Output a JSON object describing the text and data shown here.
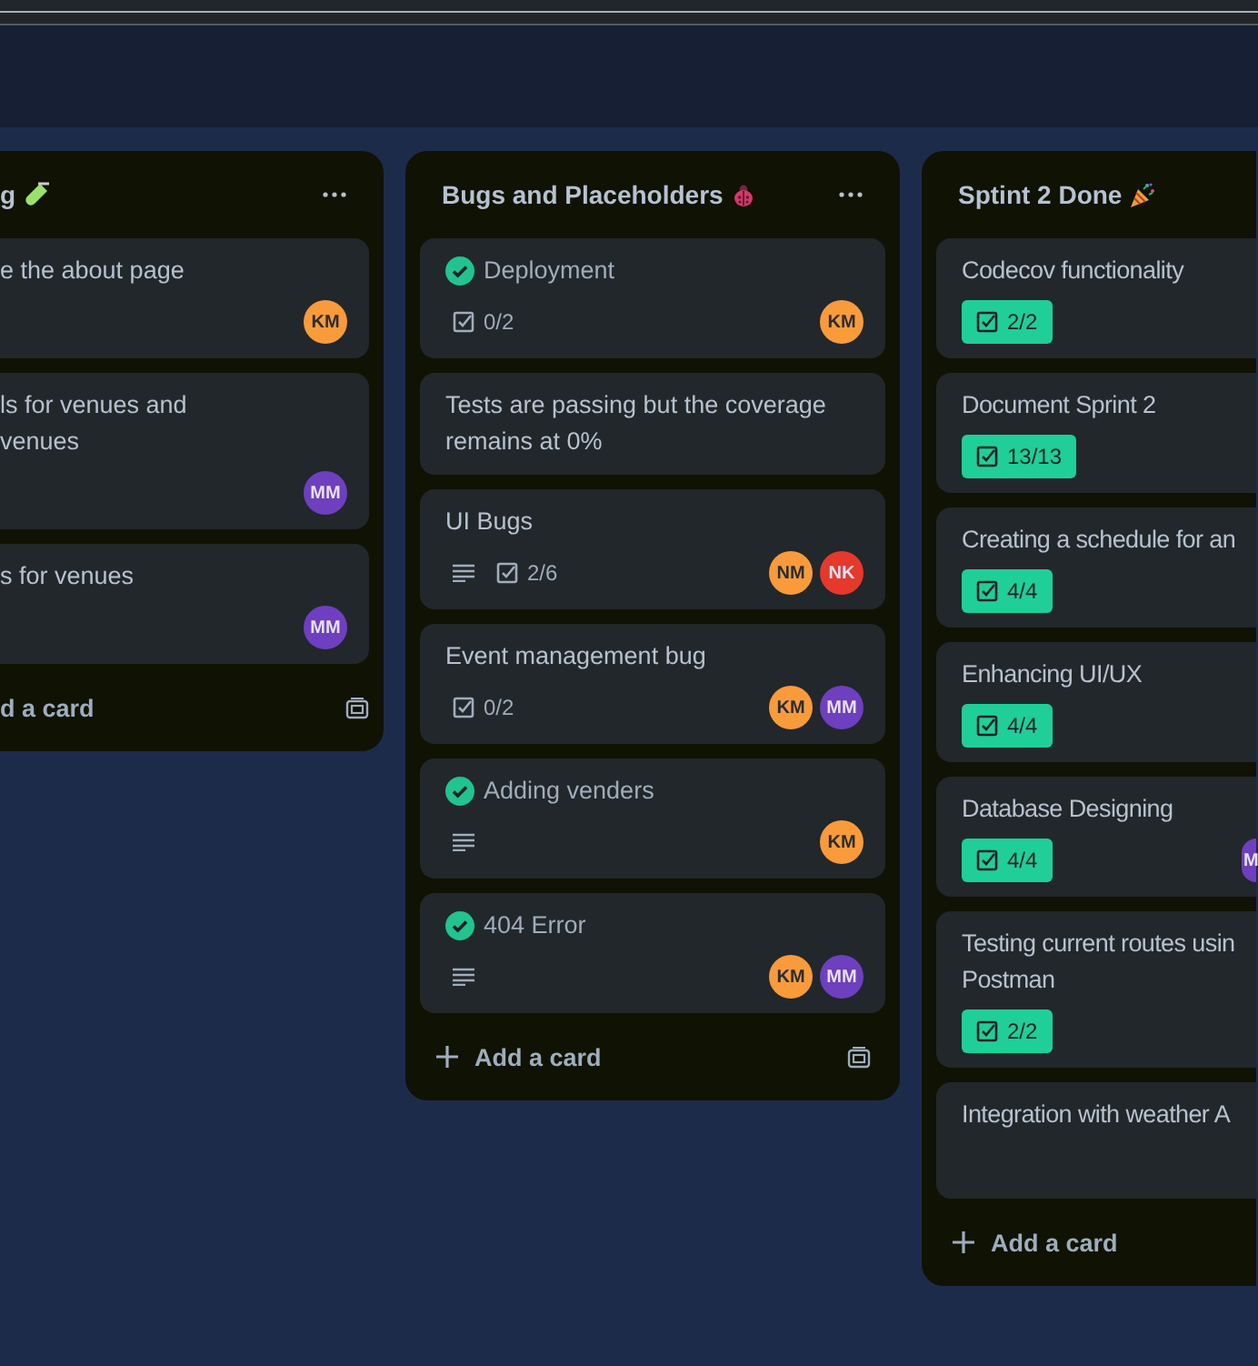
{
  "columns": [
    {
      "title": "g",
      "menu": true,
      "cards": [
        {
          "title": "e the about page",
          "done": false,
          "description": false,
          "members": [
            {
              "initials": "KM",
              "color": "#f99b3b"
            }
          ]
        },
        {
          "title": "ls for venues and\nvenues",
          "done": false,
          "description": false,
          "members": [
            {
              "initials": "MM",
              "color": "#6e3fbf"
            }
          ]
        },
        {
          "title": "s for venues",
          "done": false,
          "description": false,
          "members": [
            {
              "initials": "MM",
              "color": "#6e3fbf"
            }
          ]
        }
      ],
      "add_label": "d a card"
    },
    {
      "title": "Bugs and Placeholders",
      "menu": true,
      "cards": [
        {
          "title": "Deployment",
          "done": true,
          "description": false,
          "checklist": {
            "text": "0/2",
            "complete": false
          },
          "members": [
            {
              "initials": "KM",
              "color": "#f99b3b"
            }
          ]
        },
        {
          "title": "Tests are passing but the coverage remains at 0%",
          "done": false,
          "description": false
        },
        {
          "title": "UI Bugs",
          "done": false,
          "description": true,
          "checklist": {
            "text": "2/6",
            "complete": false
          },
          "members": [
            {
              "initials": "NM",
              "color": "#f99b3b"
            },
            {
              "initials": "NK",
              "color": "#e5392b"
            }
          ]
        },
        {
          "title": "Event management bug",
          "done": false,
          "description": false,
          "checklist": {
            "text": "0/2",
            "complete": false
          },
          "members": [
            {
              "initials": "KM",
              "color": "#f99b3b"
            },
            {
              "initials": "MM",
              "color": "#6e3fbf"
            }
          ]
        },
        {
          "title": "Adding venders",
          "done": true,
          "description": true,
          "members": [
            {
              "initials": "KM",
              "color": "#f99b3b"
            }
          ]
        },
        {
          "title": "404 Error",
          "done": true,
          "description": true,
          "members": [
            {
              "initials": "KM",
              "color": "#f99b3b"
            },
            {
              "initials": "MM",
              "color": "#6e3fbf"
            }
          ]
        }
      ],
      "add_label": "Add a card"
    },
    {
      "title": "Sptint 2 Done",
      "menu": false,
      "cards": [
        {
          "title": "Codecov functionality",
          "done": false,
          "description": false,
          "checklist": {
            "text": "2/2",
            "complete": true
          }
        },
        {
          "title": "Document Sprint 2",
          "done": false,
          "description": false,
          "checklist": {
            "text": "13/13",
            "complete": true
          }
        },
        {
          "title": "Creating a schedule for an",
          "done": false,
          "description": false,
          "checklist": {
            "text": "4/4",
            "complete": true
          }
        },
        {
          "title": "Enhancing UI/UX",
          "done": false,
          "description": false,
          "checklist": {
            "text": "4/4",
            "complete": true
          }
        },
        {
          "title": "Database Designing",
          "done": false,
          "description": false,
          "checklist": {
            "text": "4/4",
            "complete": true
          },
          "members": [
            {
              "initials": "M",
              "color": "#6e3fbf"
            }
          ]
        },
        {
          "title": "Testing current routes usin\nPostman",
          "done": false,
          "description": false,
          "checklist": {
            "text": "2/2",
            "complete": true
          }
        },
        {
          "title": "Integration with weather A",
          "done": false,
          "description": false
        }
      ],
      "add_label": "Add a card"
    }
  ]
}
